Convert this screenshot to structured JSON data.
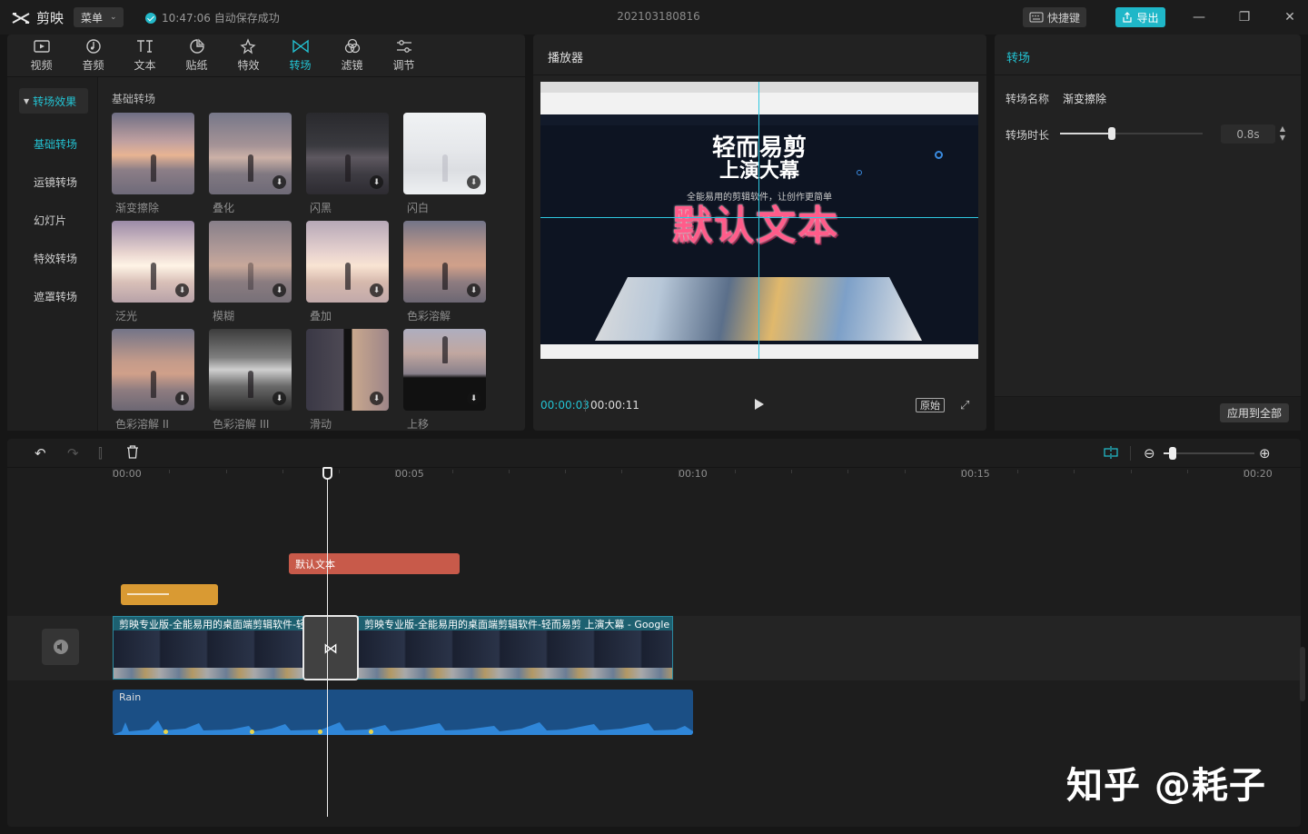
{
  "titlebar": {
    "app_name": "剪映",
    "menu_label": "菜单",
    "save_status": "10:47:06 自动保存成功",
    "project_name": "202103180816",
    "shortcut_label": "快捷键",
    "export_label": "导出"
  },
  "toolbar": {
    "tabs": [
      {
        "label": "视频",
        "icon": "video-icon"
      },
      {
        "label": "音频",
        "icon": "audio-icon"
      },
      {
        "label": "文本",
        "icon": "text-icon"
      },
      {
        "label": "贴纸",
        "icon": "sticker-icon"
      },
      {
        "label": "特效",
        "icon": "effects-icon"
      },
      {
        "label": "转场",
        "icon": "transition-icon",
        "active": true
      },
      {
        "label": "滤镜",
        "icon": "filter-icon"
      },
      {
        "label": "调节",
        "icon": "adjust-icon"
      }
    ]
  },
  "categories": {
    "header": "转场效果",
    "items": [
      "基础转场",
      "运镜转场",
      "幻灯片",
      "特效转场",
      "遮罩转场"
    ]
  },
  "transitions": {
    "section_title": "基础转场",
    "items": [
      "渐变擦除",
      "叠化",
      "闪黑",
      "闪白",
      "泛光",
      "模糊",
      "叠加",
      "色彩溶解",
      "色彩溶解 II",
      "色彩溶解 III",
      "滑动",
      "上移"
    ]
  },
  "player": {
    "title": "播放器",
    "current_time": "00:00:03",
    "duration": "00:00:11",
    "original_label": "原始",
    "preview": {
      "headline_1": "轻而易剪",
      "headline_2": "上演大幕",
      "subtitle": "全能易用的剪辑软件，让创作更简单",
      "overlay_text": "默认文本"
    }
  },
  "properties": {
    "title": "转场",
    "name_label": "转场名称",
    "name_value": "渐变擦除",
    "duration_label": "转场时长",
    "duration_value": "0.8s",
    "duration_fraction": 0.36,
    "apply_all_label": "应用到全部"
  },
  "timeline": {
    "ruler": [
      "00:00",
      "00:05",
      "00:10",
      "00:15",
      "00:20"
    ],
    "text_clip_label": "默认文本",
    "video_clip_1_label": "剪映专业版-全能易用的桌面端剪辑软件-轻而易剪 上演大幕 - Google Chrome",
    "video_clip_2_label": "剪映专业版-全能易用的桌面端剪辑软件-轻而易剪 上演大幕 - Google Chrome",
    "audio_clip_label": "Rain"
  },
  "watermark": "知乎 @耗子",
  "colors": {
    "accent": "#23c3d3",
    "text_clip": "#c85a4a",
    "sticker_clip": "#d99a33",
    "audio_clip": "#1b4f85"
  }
}
